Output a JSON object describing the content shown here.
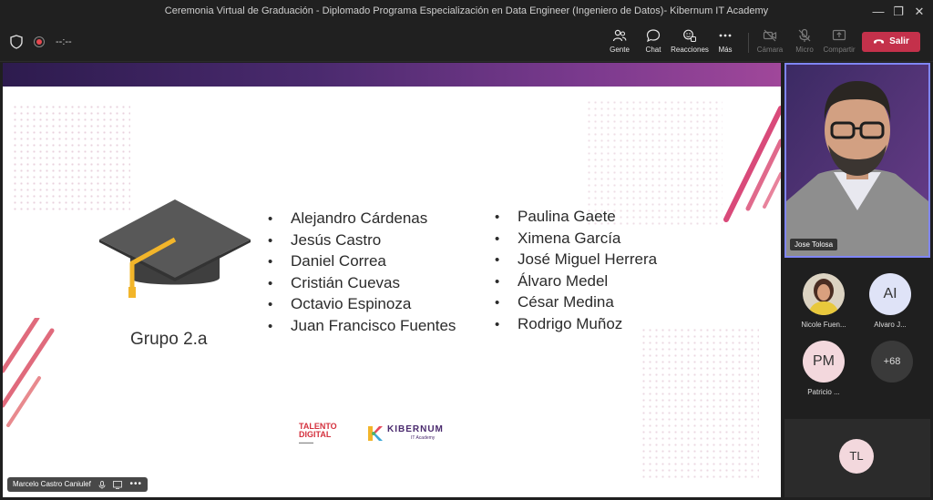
{
  "window": {
    "title": "Ceremonia Virtual de Graduación - Diplomado Programa Especialización en Data Engineer (Ingeniero de Datos)- Kibernum IT Academy"
  },
  "toolbar": {
    "timer": "--:--",
    "buttons": [
      {
        "label": "Gente",
        "icon": "people-icon"
      },
      {
        "label": "Chat",
        "icon": "chat-icon"
      },
      {
        "label": "Reacciones",
        "icon": "reactions-icon"
      },
      {
        "label": "Más",
        "icon": "more-icon"
      },
      {
        "label": "Cámara",
        "icon": "camera-off-icon",
        "disabled": true
      },
      {
        "label": "Micro",
        "icon": "mic-off-icon",
        "disabled": true
      },
      {
        "label": "Compartir",
        "icon": "share-icon",
        "disabled": true
      }
    ],
    "leave_label": "Salir",
    "leave_color": "#c4314b"
  },
  "slide": {
    "group_label": "Grupo 2.a",
    "column1": [
      "Alejandro Cárdenas",
      "Jesús Castro",
      "Daniel Correa",
      "Cristián Cuevas",
      "Octavio Espinoza",
      "Juan Francisco Fuentes"
    ],
    "column2": [
      "Paulina  Gaete",
      "Ximena García",
      "José Miguel Herrera",
      "Álvaro  Medel",
      "César Medina",
      "Rodrigo  Muñoz"
    ],
    "logo1": {
      "line1": "TALENTO",
      "line2": "DIGITAL"
    },
    "logo2": {
      "name": "KIBERNUM",
      "sub": "IT Academy"
    },
    "presenter": "Marcelo Castro Caniulef"
  },
  "speaker": {
    "name": "Jose Tolosa"
  },
  "participants": [
    {
      "name": "Nicole Fuen...",
      "initials": ""
    },
    {
      "name": "Alvaro J...",
      "initials": "AI"
    },
    {
      "name": "Patricio ...",
      "initials": "PM"
    }
  ],
  "more_count": "+68",
  "self_initials": "TL"
}
